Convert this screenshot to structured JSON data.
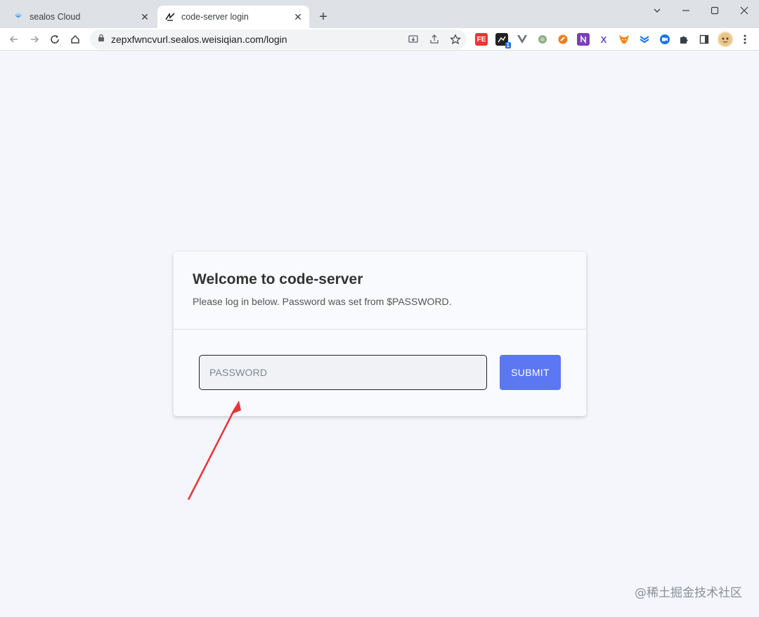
{
  "browser": {
    "tabs": [
      {
        "title": "sealos Cloud",
        "favicon": "sealos-icon",
        "active": false
      },
      {
        "title": "code-server login",
        "favicon": "code-server-icon",
        "active": true
      }
    ],
    "url": "zepxfwncvurl.sealos.weisiqian.com/login",
    "extensions": [
      "fe-ext",
      "monitor-ext",
      "vue-ext",
      "green-ext",
      "orange-ext",
      "onenote-ext",
      "x-ext",
      "metamask-ext",
      "flash-ext",
      "meeting-ext"
    ],
    "extension_badge": "1",
    "extension_labels": {
      "fe": "FE",
      "x": "X"
    }
  },
  "login": {
    "title": "Welcome to code-server",
    "subtitle": "Please log in below. Password was set from $PASSWORD.",
    "password_placeholder": "PASSWORD",
    "submit_label": "SUBMIT"
  },
  "watermark": "@稀土掘金技术社区",
  "colors": {
    "accent": "#5b77f2",
    "page_bg": "#f4f6fb",
    "annotation_arrow": "#e8333a"
  }
}
